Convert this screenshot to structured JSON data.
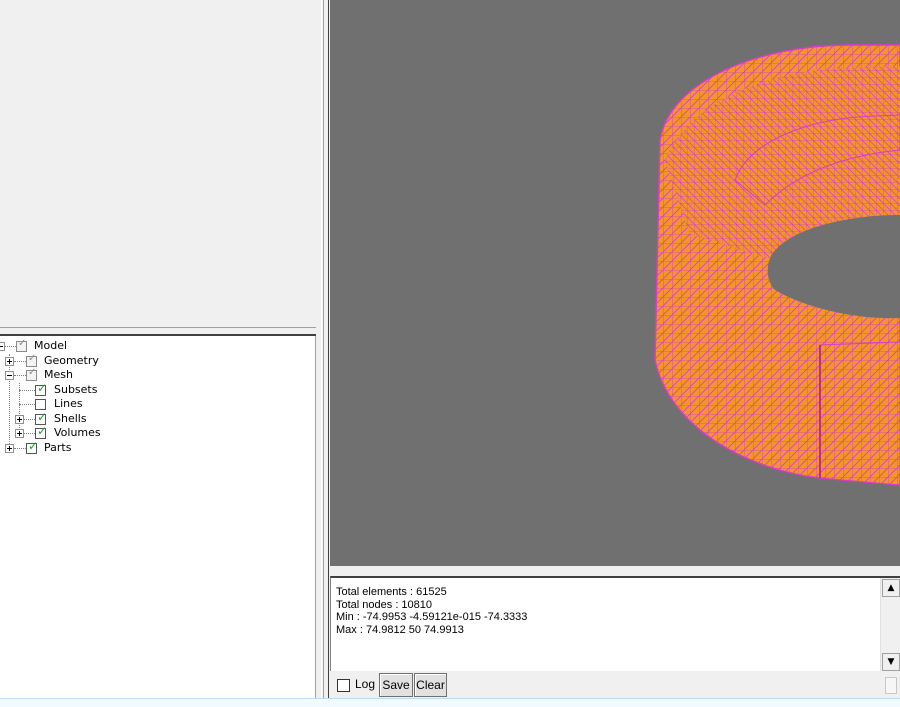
{
  "tree": {
    "items": [
      {
        "label": "Model",
        "checked": "gray"
      },
      {
        "label": "Geometry",
        "checked": "gray"
      },
      {
        "label": "Mesh",
        "checked": "gray"
      },
      {
        "label": "Subsets",
        "checked": "green"
      },
      {
        "label": "Lines",
        "checked": "none"
      },
      {
        "label": "Shells",
        "checked": "green"
      },
      {
        "label": "Volumes",
        "checked": "green"
      },
      {
        "label": "Parts",
        "checked": "green"
      }
    ]
  },
  "viewport": {
    "background_color": "#707070",
    "mesh_fill_color": "#f2962a",
    "mesh_line_color": "#d83cc8"
  },
  "log": {
    "lines": [
      "Total elements : 61525",
      "Total nodes : 10810",
      "Min : -74.9953 -4.59121e-015 -74.3333",
      "Max : 74.9812 50 74.9913"
    ],
    "log_checkbox_label": "Log",
    "save_label": "Save",
    "clear_label": "Clear"
  },
  "icons": {
    "scroll_up": "scroll-up-arrow-icon",
    "scroll_down": "scroll-down-arrow-icon",
    "check": "check-icon"
  }
}
